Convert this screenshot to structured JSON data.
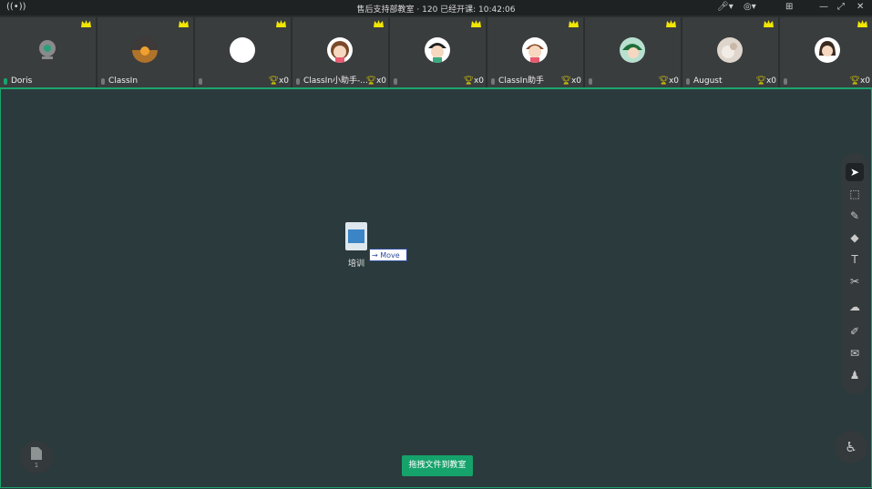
{
  "topbar": {
    "live_icon": "live-signal-icon",
    "title": "售后支持部教室 · 120   已经开课: 10:42:06",
    "controls": [
      "mic-dropdown-icon",
      "camera-dropdown-icon",
      "grid-icon",
      "minimize-icon",
      "restore-icon",
      "close-icon"
    ]
  },
  "participants": [
    {
      "name": "Doris",
      "trophy": "",
      "mic_on": true
    },
    {
      "name": "ClassIn",
      "trophy": "",
      "mic_on": false
    },
    {
      "name": "",
      "trophy": "x0",
      "mic_on": false
    },
    {
      "name": "ClassIn小助手-...",
      "trophy": "x0",
      "mic_on": false
    },
    {
      "name": "",
      "trophy": "x0",
      "mic_on": false
    },
    {
      "name": "ClassIn助手",
      "trophy": "x0",
      "mic_on": false
    },
    {
      "name": "",
      "trophy": "x0",
      "mic_on": false
    },
    {
      "name": "August",
      "trophy": "x0",
      "mic_on": false
    },
    {
      "name": "",
      "trophy": "x0",
      "mic_on": false
    }
  ],
  "board": {
    "file_label": "培训",
    "move_badge": "Move",
    "drag_button": "拖拽文件到教室",
    "page_number": "1"
  },
  "toolbar": {
    "tools": [
      "pointer-icon",
      "select-icon",
      "pen-icon",
      "eraser-icon",
      "text-icon",
      "scissors-icon",
      "cloud-icon",
      "edit-icon",
      "chat-icon",
      "users-icon"
    ]
  },
  "colors": {
    "accent": "#1aa56e",
    "board": "#2b3a3c",
    "crown": "#f2e600"
  }
}
